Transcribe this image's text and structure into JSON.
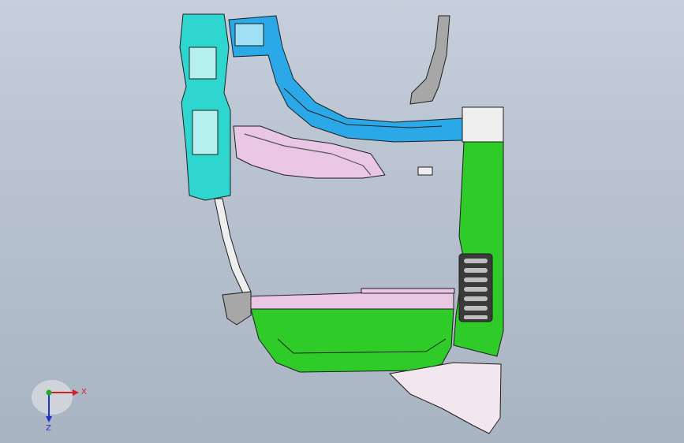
{
  "viewport": {
    "background_top": "#c6cfdb",
    "background_bottom": "#a9b4c3"
  },
  "colors": {
    "green_panel": "#2fcb28",
    "green_dark": "#1f9d1a",
    "cyan_part": "#2fd6d0",
    "blue_part": "#2aa8e8",
    "pink_part": "#e9c6e4",
    "grey_part": "#a7a7a7",
    "white_part": "#eeeeee",
    "edge": "#1e1e1e"
  },
  "axis_triad": {
    "x_label": "X",
    "z_label": "Z",
    "x_color": "#d42020",
    "y_color": "#1fae2a",
    "z_color": "#2035c8"
  }
}
